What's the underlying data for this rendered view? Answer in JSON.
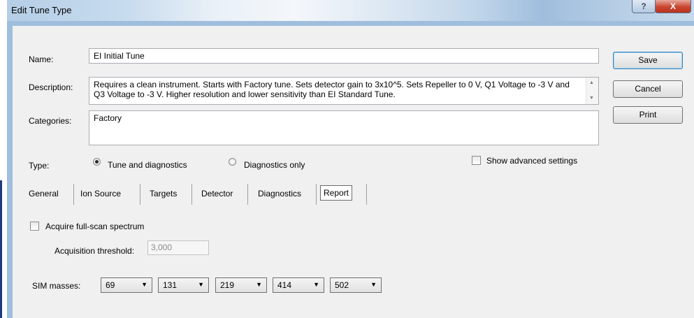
{
  "window": {
    "title": "Edit Tune Type",
    "help_symbol": "?",
    "close_symbol": "X"
  },
  "form": {
    "name_label": "Name:",
    "name_value": "EI Initial Tune",
    "description_label": "Description:",
    "description_value": "Requires a clean instrument. Starts with Factory tune. Sets detector gain to 3x10^5. Sets Repeller to 0 V, Q1 Voltage to -3 V and Q3 Voltage to -3 V. Higher resolution and lower sensitivity than EI Standard Tune.",
    "categories_label": "Categories:",
    "categories_value": "Factory",
    "type_label": "Type:",
    "type_options": [
      "Tune and diagnostics",
      "Diagnostics only"
    ],
    "type_selected": "Tune and diagnostics",
    "show_advanced_label": "Show advanced settings",
    "show_advanced_checked": false
  },
  "buttons": {
    "save": "Save",
    "cancel": "Cancel",
    "print": "Print"
  },
  "tabs": [
    "General",
    "Ion Source",
    "Targets",
    "Detector",
    "Diagnostics",
    "Report"
  ],
  "active_tab": "Report",
  "report": {
    "acquire_full_scan_label": "Acquire full-scan spectrum",
    "acquire_full_scan_checked": false,
    "acquisition_threshold_label": "Acquisition threshold:",
    "acquisition_threshold_value": "3,000",
    "sim_masses_label": "SIM masses:",
    "sim_masses": [
      "69",
      "131",
      "219",
      "414",
      "502"
    ]
  }
}
